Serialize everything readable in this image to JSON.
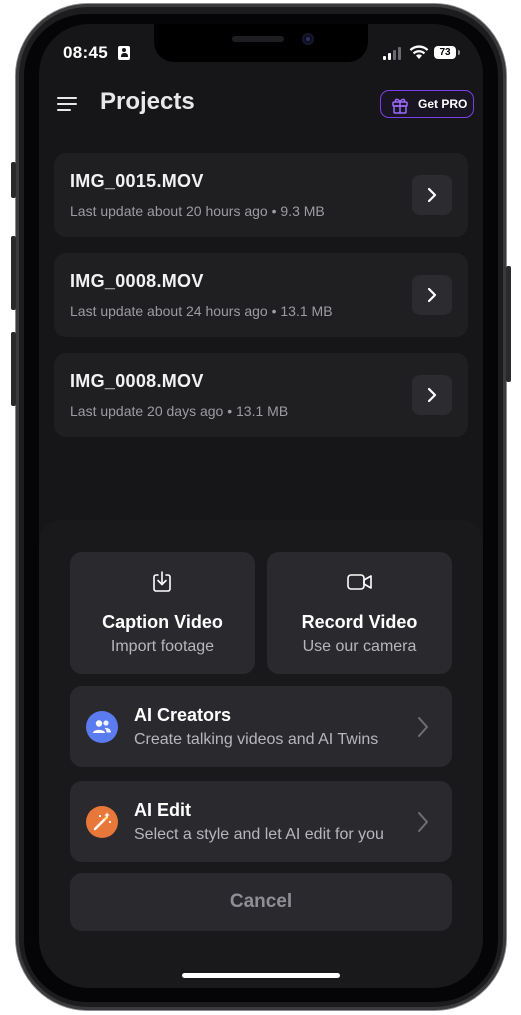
{
  "status_bar": {
    "time": "08:45",
    "battery": "73"
  },
  "header": {
    "title": "Projects",
    "pro_button_label": "Get PRO"
  },
  "projects": [
    {
      "name": "IMG_0015.MOV",
      "meta": "Last update about 20 hours ago • 9.3 MB"
    },
    {
      "name": "IMG_0008.MOV",
      "meta": "Last update about 24 hours ago • 13.1 MB"
    },
    {
      "name": "IMG_0008.MOV",
      "meta": "Last update 20 days ago • 13.1 MB"
    }
  ],
  "sheet": {
    "tiles": [
      {
        "title": "Caption Video",
        "subtitle": "Import footage",
        "icon": "import-icon"
      },
      {
        "title": "Record Video",
        "subtitle": "Use our camera",
        "icon": "video-camera-icon"
      }
    ],
    "rows": [
      {
        "title": "AI Creators",
        "subtitle": "Create talking videos and AI Twins",
        "icon": "people-icon",
        "color": "#5a7cf0"
      },
      {
        "title": "AI Edit",
        "subtitle": "Select a style and let AI edit for you",
        "icon": "magic-wand-icon",
        "color": "#e8773a"
      }
    ],
    "cancel_label": "Cancel"
  },
  "colors": {
    "background": "#161618",
    "card": "#1f1f22",
    "sheet": "#19191c",
    "pro_border": "#7b3fe4"
  }
}
